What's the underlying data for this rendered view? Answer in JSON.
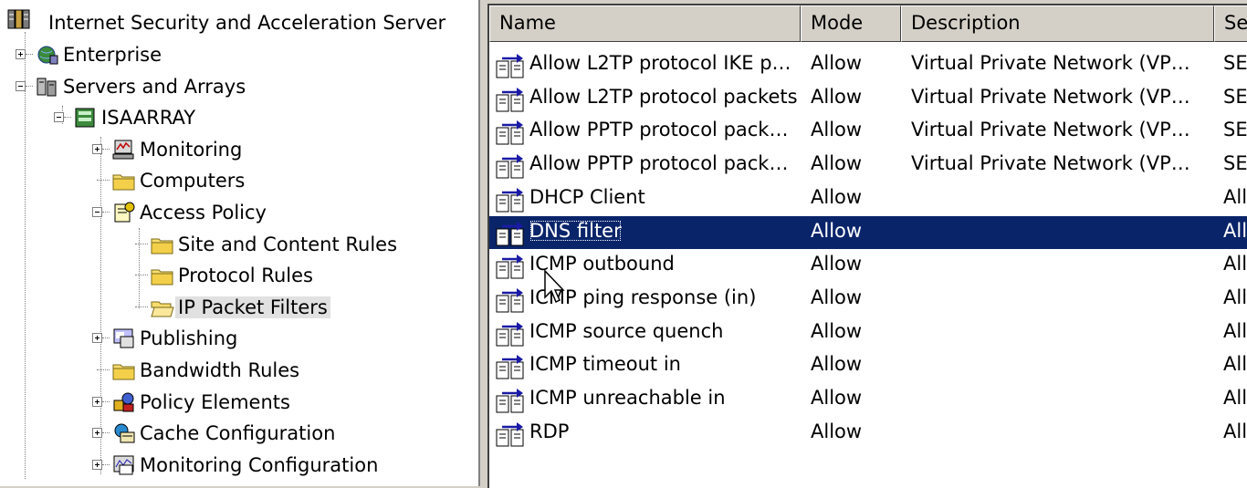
{
  "tree": {
    "root": {
      "label": "Internet Security and Acceleration Server",
      "icon": "isa-server-icon"
    },
    "items": [
      {
        "label": "Enterprise",
        "icon": "enterprise-globe-icon",
        "expander": "plus"
      },
      {
        "label": "Servers and Arrays",
        "icon": "servers-icon",
        "expander": "minus"
      },
      {
        "label": "ISAARRAY",
        "icon": "array-icon",
        "expander": "minus"
      },
      {
        "label": "Monitoring",
        "icon": "monitoring-icon",
        "expander": "plus"
      },
      {
        "label": "Computers",
        "icon": "folder-icon",
        "expander": "none"
      },
      {
        "label": "Access Policy",
        "icon": "access-policy-icon",
        "expander": "minus"
      },
      {
        "label": "Site and Content Rules",
        "icon": "folder-icon",
        "expander": "none"
      },
      {
        "label": "Protocol Rules",
        "icon": "folder-icon",
        "expander": "none"
      },
      {
        "label": "IP Packet Filters",
        "icon": "folder-open-icon",
        "expander": "none",
        "selected": true
      },
      {
        "label": "Publishing",
        "icon": "publishing-icon",
        "expander": "plus"
      },
      {
        "label": "Bandwidth Rules",
        "icon": "folder-icon",
        "expander": "none"
      },
      {
        "label": "Policy Elements",
        "icon": "policy-elements-icon",
        "expander": "plus"
      },
      {
        "label": "Cache Configuration",
        "icon": "cache-icon",
        "expander": "plus"
      },
      {
        "label": "Monitoring Configuration",
        "icon": "monitoring-config-icon",
        "expander": "plus"
      }
    ]
  },
  "list": {
    "columns": [
      "Name",
      "Mode",
      "Description",
      "Ser"
    ],
    "rows": [
      {
        "name": "Allow L2TP protocol IKE p…",
        "mode": "Allow",
        "description": "Virtual Private Network (VP…",
        "service": "SEF"
      },
      {
        "name": "Allow L2TP protocol packets",
        "mode": "Allow",
        "description": "Virtual Private Network (VP…",
        "service": "SEF"
      },
      {
        "name": "Allow PPTP protocol pack…",
        "mode": "Allow",
        "description": "Virtual Private Network (VP…",
        "service": "SEF"
      },
      {
        "name": "Allow PPTP protocol pack…",
        "mode": "Allow",
        "description": "Virtual Private Network (VP…",
        "service": "SEF"
      },
      {
        "name": "DHCP Client",
        "mode": "Allow",
        "description": "",
        "service": "All"
      },
      {
        "name": "DNS filter",
        "mode": "Allow",
        "description": "",
        "service": "All",
        "selected": true
      },
      {
        "name": "ICMP outbound",
        "mode": "Allow",
        "description": "",
        "service": "All"
      },
      {
        "name": "ICMP ping response (in)",
        "mode": "Allow",
        "description": "",
        "service": "All"
      },
      {
        "name": "ICMP source quench",
        "mode": "Allow",
        "description": "",
        "service": "All"
      },
      {
        "name": "ICMP timeout in",
        "mode": "Allow",
        "description": "",
        "service": "All"
      },
      {
        "name": "ICMP unreachable in",
        "mode": "Allow",
        "description": "",
        "service": "All"
      },
      {
        "name": "RDP",
        "mode": "Allow",
        "description": "",
        "service": "All"
      }
    ],
    "row_icon": "packet-filter-icon"
  },
  "colors": {
    "selection": "#0a246a",
    "folder": "#f7dc6f",
    "arrow": "#1a1aa6"
  }
}
